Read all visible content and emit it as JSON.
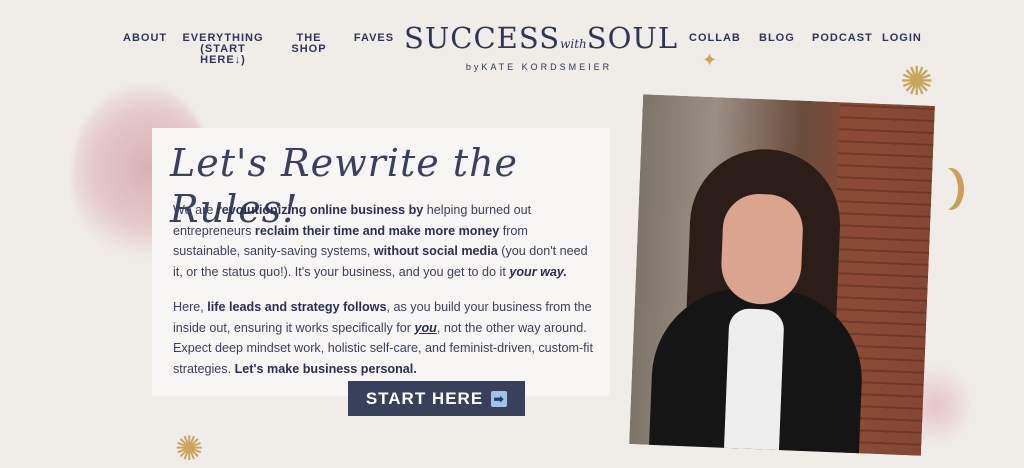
{
  "nav": {
    "about": "ABOUT",
    "everything_line1": "EVERYTHING",
    "everything_line2": "(START HERE↓)",
    "shop": "THE SHOP",
    "faves": "FAVES",
    "collab": "COLLAB",
    "blog": "BLOG",
    "podcast": "PODCAST",
    "login": "LOGIN"
  },
  "logo": {
    "word1": "SUCCESS",
    "with": "with",
    "word2": "SOUL",
    "byline": "byKATE KORDSMEIER"
  },
  "hero": {
    "headline": "Let's Rewrite the Rules!",
    "p1_a": "We are ",
    "p1_b": "revolutionizing online business by",
    "p1_c": " helping burned out entrepreneurs ",
    "p1_d": "reclaim their time and make more money",
    "p1_e": " from sustainable, sanity-saving systems, ",
    "p1_f": "without social media",
    "p1_g": " (you don't need it, or the status quo!). It's your business, and you get to do it ",
    "p1_h": "your way.",
    "p2_a": "Here, ",
    "p2_b": "life leads and strategy follows",
    "p2_c": ", as you build your business from the inside out, ensuring it works specifically for ",
    "p2_d": "you",
    "p2_e": ", not the other way around. Expect deep mindset work, holistic self-care, and feminist-driven, custom-fit strategies. ",
    "p2_f": "Let's make business personal.",
    "cta_label": "START HERE",
    "cta_icon": "➡"
  },
  "colors": {
    "navy": "#2f3557",
    "button": "#38405c",
    "gold": "#c9a65c",
    "blush": "#e3c2c6"
  }
}
